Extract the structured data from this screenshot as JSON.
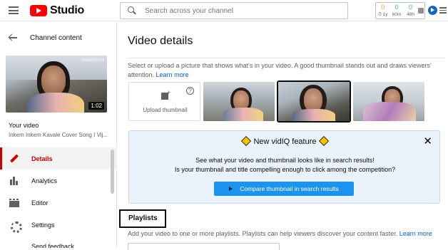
{
  "topbar": {
    "logo_text": "Studio",
    "search_placeholder": "Search across your channel",
    "stats": [
      {
        "value": "0",
        "label": "⏱ 1y",
        "color": "orange"
      },
      {
        "value": "0",
        "label": "60m",
        "color": "blue"
      },
      {
        "value": "0",
        "label": "48h",
        "color": "blue"
      }
    ]
  },
  "sidebar": {
    "back_label": "Channel content",
    "duration": "1:02",
    "thumb_tag": "KINEMASTER",
    "your_video": "Your video",
    "video_title": "Inkem Inkem Kavale Cover Song I Vij...",
    "nav": [
      {
        "label": "Details",
        "active": true
      },
      {
        "label": "Analytics",
        "active": false
      },
      {
        "label": "Editor",
        "active": false
      },
      {
        "label": "Settings",
        "active": false
      }
    ],
    "next_peek": "Send feedback"
  },
  "main": {
    "title": "Video details",
    "thumbnail_desc": "Select or upload a picture that shows what's in your video. A good thumbnail stands out and draws viewers' attention.",
    "learn_more": "Learn more",
    "upload_label": "Upload thumbnail",
    "selected_thumbnail_index": 1,
    "vidiq": {
      "title": "New vidIQ feature",
      "line1": "See what your video and thumbnail looks like in search results!",
      "line2": "Is your thumbnail and title compelling enough to click among the competition?",
      "button": "Compare thumbnail in search results",
      "close": "✕"
    },
    "playlists": {
      "heading": "Playlists",
      "desc": "Add your video to one or more playlists. Playlists can help viewers discover your content faster.",
      "learn_more": "Learn more"
    }
  },
  "colors": {
    "accent_red": "#cc0000",
    "link_blue": "#065fd4",
    "vidiq_button": "#1c93ee"
  }
}
